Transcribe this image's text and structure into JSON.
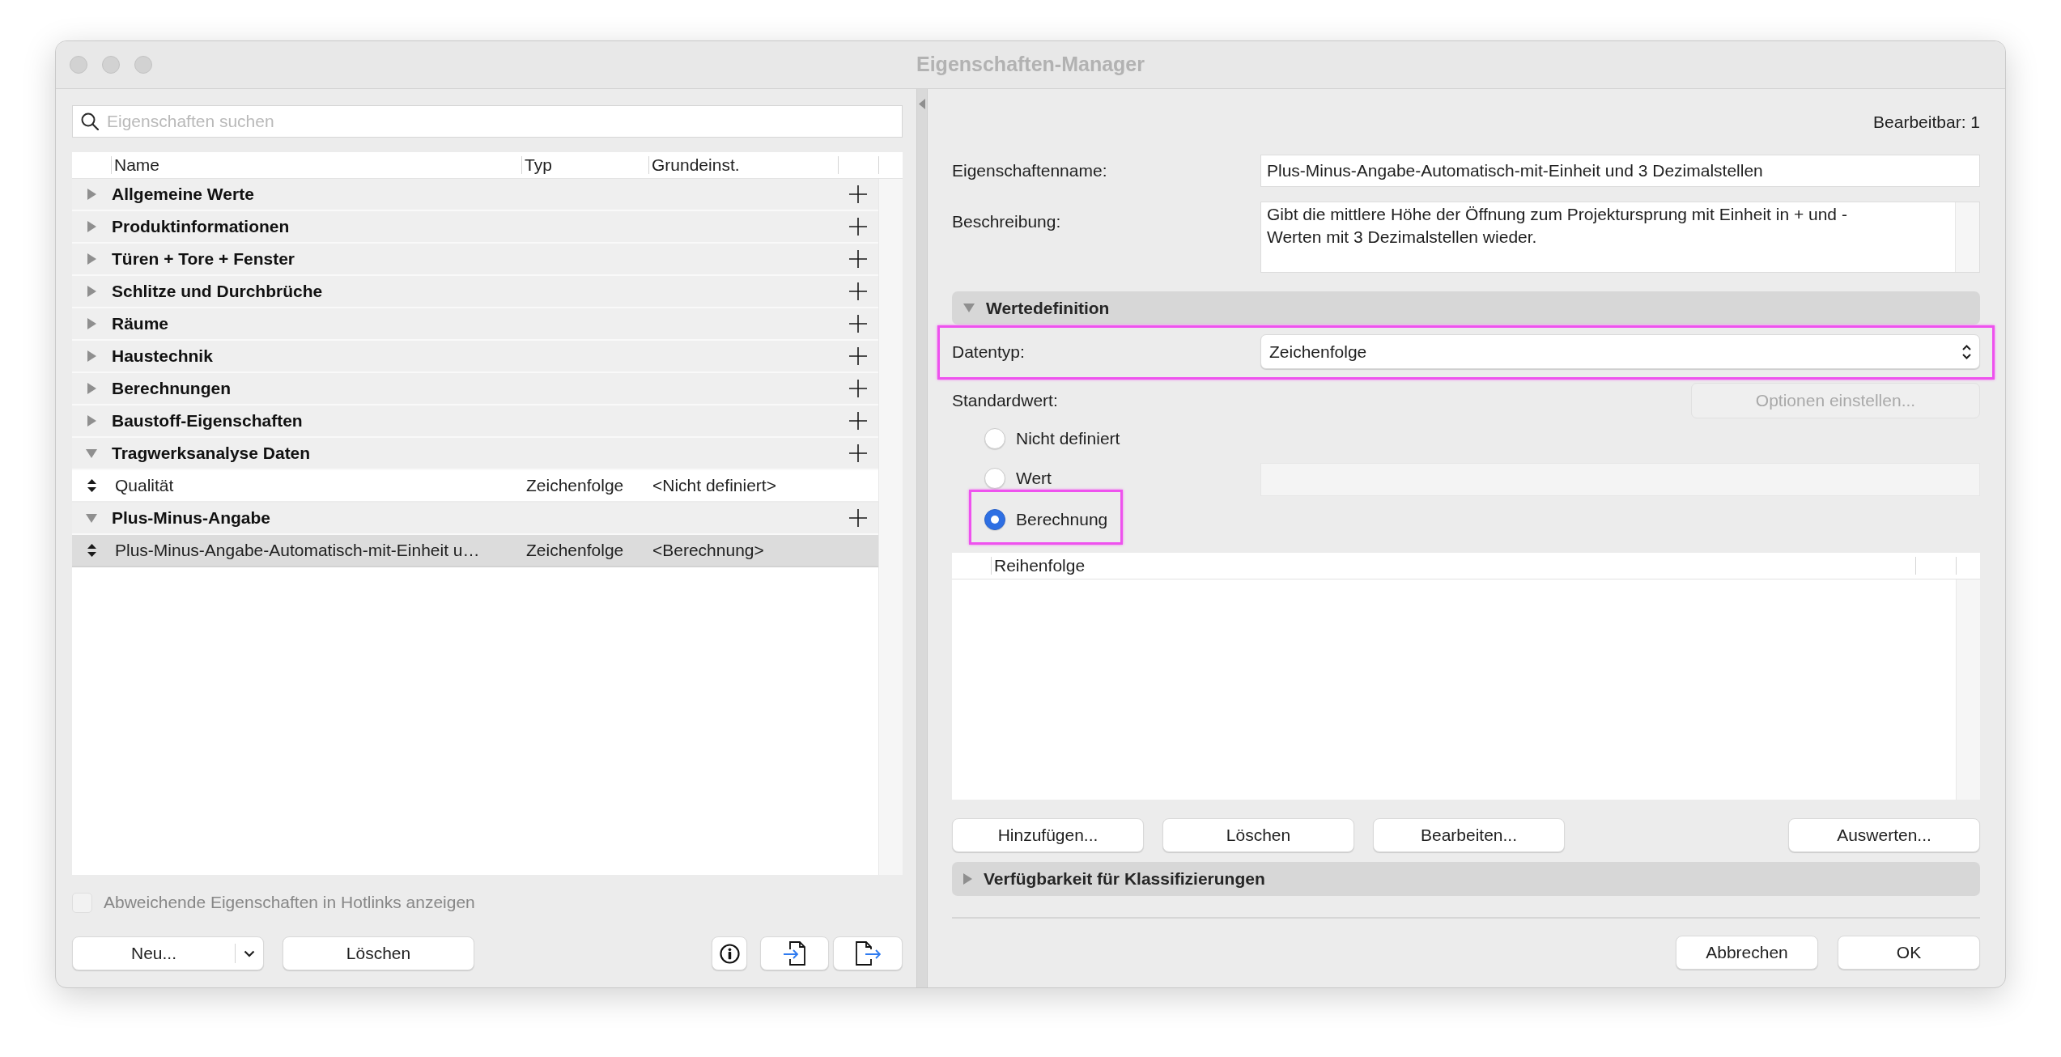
{
  "window": {
    "title": "Eigenschaften-Manager"
  },
  "left_panel": {
    "search": {
      "placeholder": "Eigenschaften suchen"
    },
    "table": {
      "columns": [
        "Name",
        "Typ",
        "Grundeinst."
      ],
      "groups": [
        {
          "name": "Allgemeine Werte",
          "expanded": false
        },
        {
          "name": "Produktinformationen",
          "expanded": false
        },
        {
          "name": "Türen + Tore + Fenster",
          "expanded": false
        },
        {
          "name": "Schlitze und Durchbrüche",
          "expanded": false
        },
        {
          "name": "Räume",
          "expanded": false
        },
        {
          "name": "Haustechnik",
          "expanded": false
        },
        {
          "name": "Berechnungen",
          "expanded": false
        },
        {
          "name": "Baustoff-Eigenschaften",
          "expanded": false
        },
        {
          "name": "Tragwerksanalyse Daten",
          "expanded": true,
          "children": [
            {
              "name": "Qualität",
              "type": "Zeichenfolge",
              "default": "<Nicht definiert>",
              "selected": false
            }
          ]
        },
        {
          "name": "Plus-Minus-Angabe",
          "expanded": true,
          "children": [
            {
              "name": "Plus-Minus-Angabe-Automatisch-mit-Einheit u…",
              "type": "Zeichenfolge",
              "default": "<Berechnung>",
              "selected": true
            }
          ]
        }
      ]
    },
    "hotlinks_checkbox": {
      "label": "Abweichende Eigenschaften in Hotlinks anzeigen",
      "checked": false,
      "disabled": true
    },
    "new_button": "Neu...",
    "delete_button": "Löschen"
  },
  "right_panel": {
    "editable_count": "Bearbeitbar: 1",
    "name_field": {
      "label": "Eigenschaftenname:",
      "value": "Plus-Minus-Angabe-Automatisch-mit-Einheit und 3 Dezimalstellen"
    },
    "description_field": {
      "label": "Beschreibung:",
      "value": "Gibt die mittlere Höhe der Öffnung zum Projektursprung mit Einheit in + und - Werten mit 3 Dezimalstellen wieder."
    },
    "value_definition": {
      "title": "Wertedefinition",
      "expanded": true,
      "data_type": {
        "label": "Datentyp:",
        "value": "Zeichenfolge",
        "highlighted": true
      },
      "default_value": {
        "label": "Standardwert:",
        "options_button": {
          "label": "Optionen einstellen...",
          "disabled": true
        },
        "choices": [
          {
            "kind": "plain",
            "label": "Nicht definiert",
            "selected": false,
            "highlighted": false
          },
          {
            "kind": "field",
            "label": "Wert",
            "selected": false,
            "highlighted": false,
            "field_disabled": true
          },
          {
            "kind": "plain",
            "label": "Berechnung",
            "selected": true,
            "highlighted": true
          }
        ]
      },
      "sequence_table": {
        "columns": [
          "Reihenfolge"
        ]
      },
      "table_buttons": [
        "Hinzufügen...",
        "Löschen",
        "Bearbeiten..."
      ],
      "evaluate_button": "Auswerten..."
    },
    "classification": {
      "title": "Verfügbarkeit für Klassifizierungen",
      "expanded": false
    },
    "footer_buttons": [
      "Abbrechen",
      "OK"
    ]
  }
}
